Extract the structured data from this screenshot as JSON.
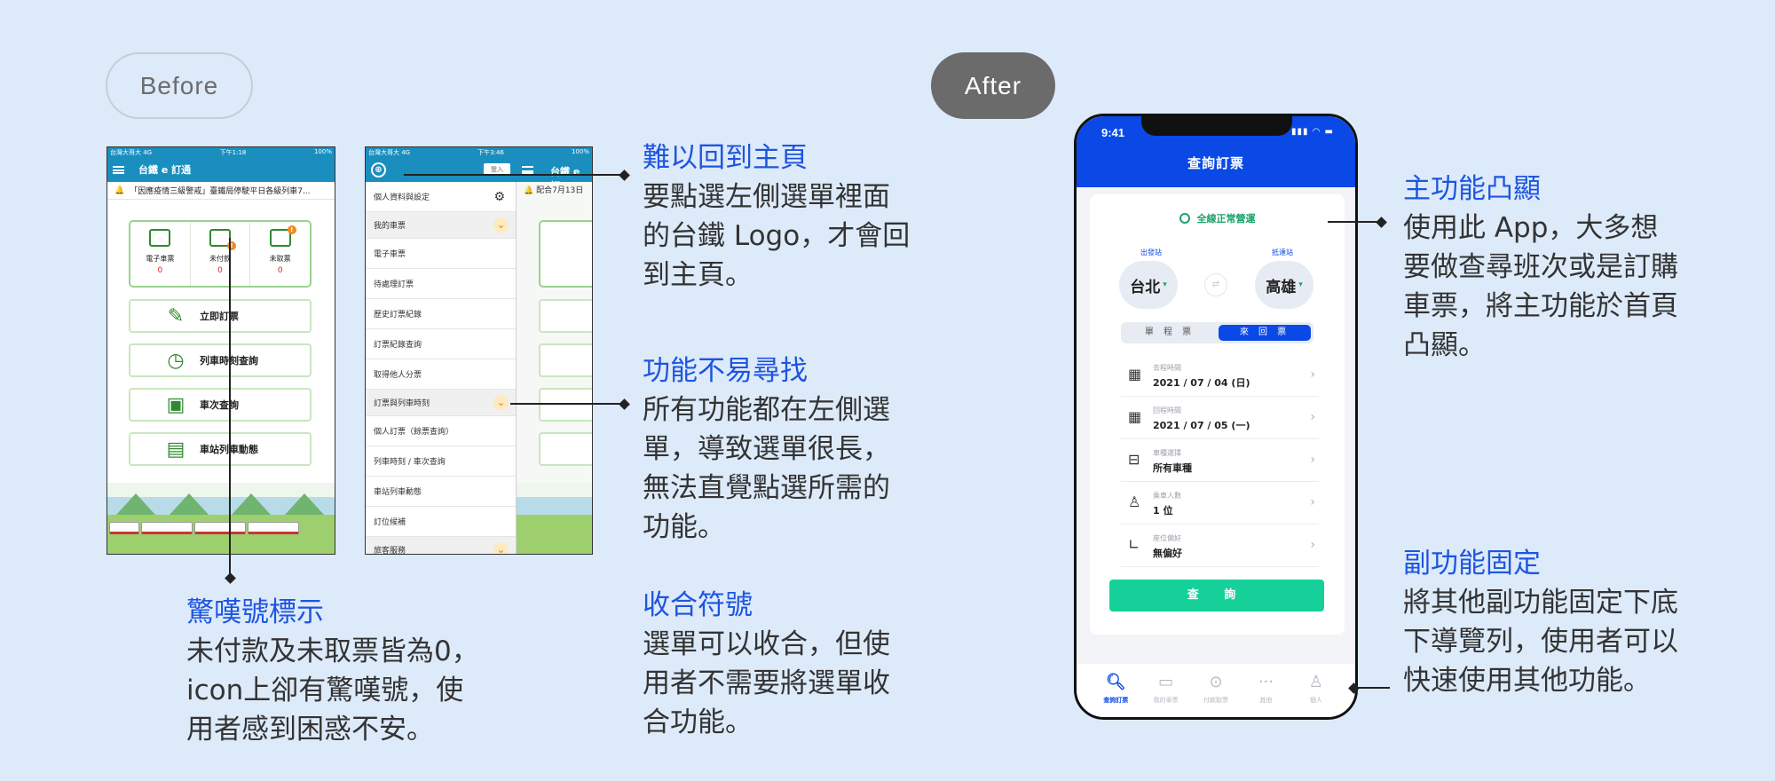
{
  "labels": {
    "before": "Before",
    "after": "After"
  },
  "old_home": {
    "status_carrier": "台灣大哥大 4G",
    "status_time": "下午1:18",
    "status_battery": "100%",
    "app_title": "台鐵 e 訂通",
    "notice": "「因應疫情三級警戒」臺鐵局停駛平日各級列車7...",
    "quick": [
      {
        "label": "電子車票",
        "value": "0"
      },
      {
        "label": "未付款",
        "value": "0"
      },
      {
        "label": "未取票",
        "value": "0"
      }
    ],
    "badge": "!",
    "buttons": [
      "立即訂票",
      "列車時刻查詢",
      "車次查詢",
      "車站列車動態"
    ]
  },
  "old_menu": {
    "status_carrier": "台灣大哥大 4G",
    "status_time": "下午3:46",
    "status_battery": "100%",
    "login": "登入",
    "peek_title": "台鐵 e 訂",
    "peek_notice": "配合7月13日",
    "items": [
      "個人資料與設定",
      "我的車票",
      "電子車票",
      "待處理訂票",
      "歷史訂票紀錄",
      "訂票紀錄查詢",
      "取得他人分票",
      "訂票與列車時刻",
      "個人訂票（餘票查詢）",
      "列車時刻 / 車次查詢",
      "車站列車動態",
      "訂位候補",
      "旅客服務"
    ]
  },
  "notes": {
    "home": {
      "title": "難以回到主頁",
      "body": "要點選左側選單裡面\n的台鐵 Logo，才會回\n到主頁。"
    },
    "find": {
      "title": "功能不易尋找",
      "body": "所有功能都在左側選\n單，導致選單很長，\n無法直覺點選所需的\n功能。"
    },
    "fold": {
      "title": "收合符號",
      "body": "選單可以收合，但使\n用者不需要將選單收\n合功能。"
    },
    "alert": {
      "title": "驚嘆號標示",
      "body": "未付款及未取票皆為0，\nicon上卻有驚嘆號，使\n用者感到困惑不安。"
    },
    "main": {
      "title": "主功能凸顯",
      "body": "使用此 App，大多想\n要做查尋班次或是訂購\n車票，將主功能於首頁\n凸顯。"
    },
    "sub": {
      "title": "副功能固定",
      "body": "將其他副功能固定下底\n下導覽列，使用者可以\n快速使用其他功能。"
    }
  },
  "new_app": {
    "time": "9:41",
    "title": "查詢訂票",
    "status": "全線正常營運",
    "from_label": "出發站",
    "to_label": "抵達站",
    "from": "台北",
    "to": "高雄",
    "seg_single": "單 程 票",
    "seg_return": "來 回 票",
    "rows": [
      {
        "label": "去程時間",
        "value": "2021 / 07 / 04 (日)"
      },
      {
        "label": "回程時間",
        "value": "2021 / 07 / 05 (一)"
      },
      {
        "label": "車種選擇",
        "value": "所有車種"
      },
      {
        "label": "乘車人數",
        "value": "1 位"
      },
      {
        "label": "座位偏好",
        "value": "無偏好"
      }
    ],
    "query": "查 詢",
    "tabs": [
      "查詢訂票",
      "我的車票",
      "付款取票",
      "其他",
      "個人"
    ]
  },
  "colors": {
    "accent": "#1e55e0",
    "app_blue": "#0a49e6",
    "go_green": "#16d09a",
    "tra_blue": "#1a8fbf"
  }
}
